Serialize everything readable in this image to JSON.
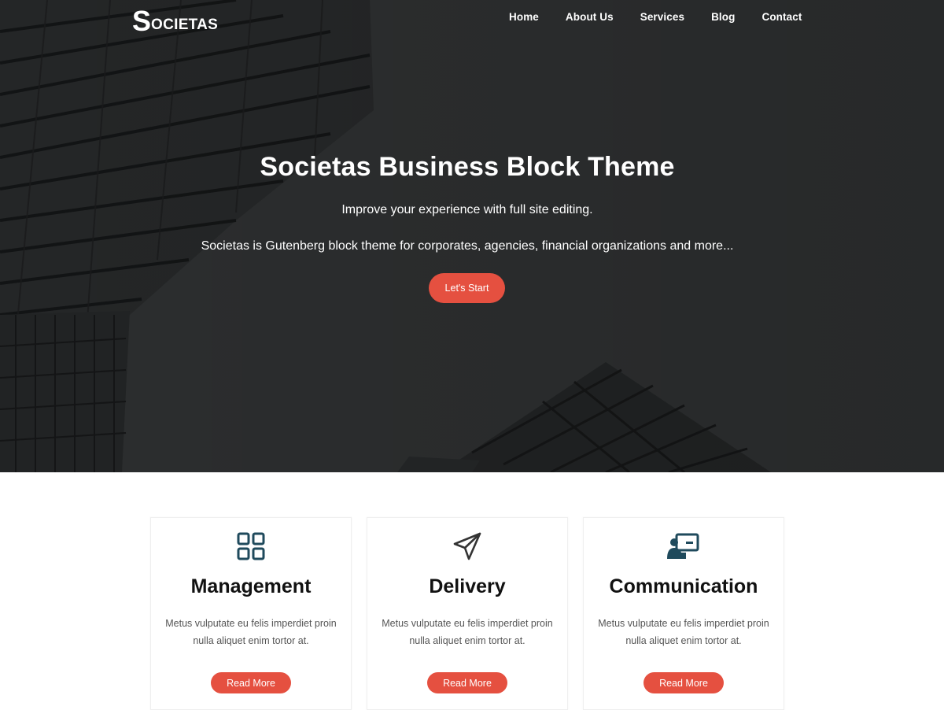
{
  "brand": {
    "logo_initial": "S",
    "logo_rest": "OCIETAS"
  },
  "nav": {
    "items": [
      {
        "label": "Home"
      },
      {
        "label": "About Us"
      },
      {
        "label": "Services"
      },
      {
        "label": "Blog"
      },
      {
        "label": "Contact"
      }
    ]
  },
  "hero": {
    "title": "Societas Business Block Theme",
    "subtitle": "Improve your experience with full site editing.",
    "description": "Societas is Gutenberg block theme for corporates, agencies, financial organizations and more...",
    "cta_label": "Let's Start"
  },
  "features": [
    {
      "icon": "grid-icon",
      "title": "Management",
      "text": "Metus vulputate eu felis imperdiet proin nulla aliquet enim tortor at.",
      "button": "Read More"
    },
    {
      "icon": "paper-plane-icon",
      "title": "Delivery",
      "text": "Metus vulputate eu felis imperdiet proin nulla aliquet enim tortor at.",
      "button": "Read More"
    },
    {
      "icon": "presentation-icon",
      "title": "Communication",
      "text": "Metus vulputate eu felis imperdiet proin nulla aliquet enim tortor at.",
      "button": "Read More"
    }
  ],
  "colors": {
    "accent": "#e55040",
    "icon": "#1f4a5c",
    "hero_bg": "#2b2d2e",
    "heading": "#111111"
  }
}
